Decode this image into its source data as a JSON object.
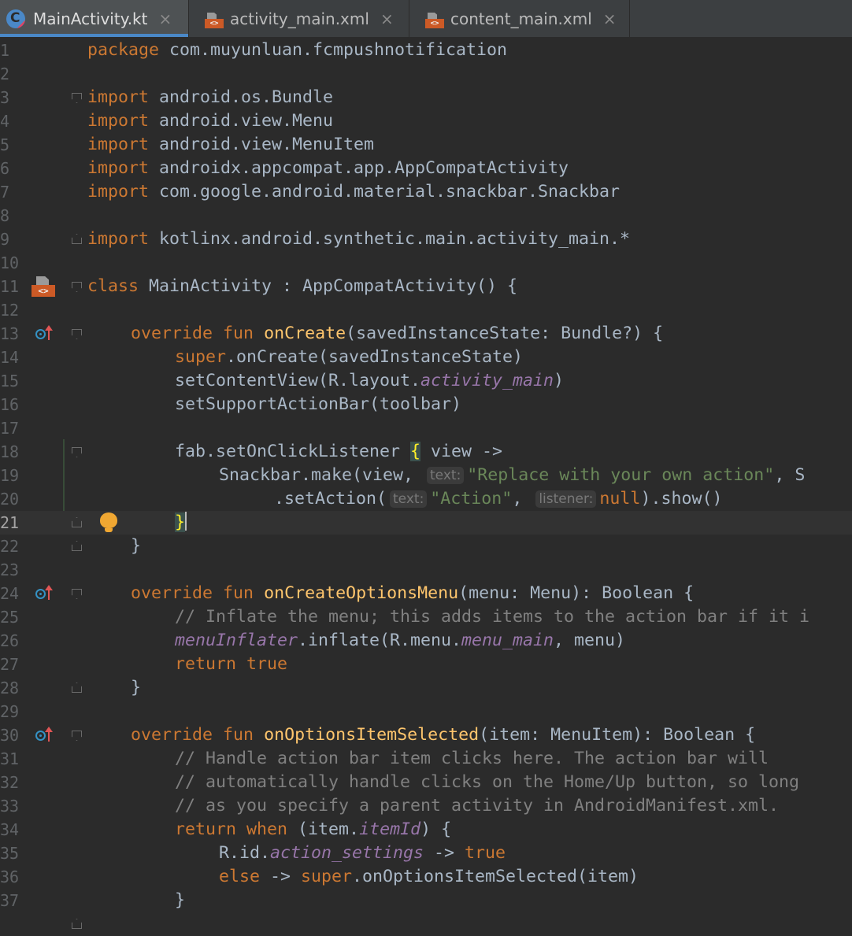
{
  "tabs": [
    {
      "label": "MainActivity.kt",
      "icon": "kotlin-file-icon",
      "active": true
    },
    {
      "label": "activity_main.xml",
      "icon": "xml-file-icon",
      "active": false
    },
    {
      "label": "content_main.xml",
      "icon": "xml-file-icon",
      "active": false
    }
  ],
  "tab_close_glyph": "×",
  "lines": [
    "1",
    "2",
    "3",
    "4",
    "5",
    "6",
    "7",
    "8",
    "9",
    "10",
    "11",
    "12",
    "13",
    "14",
    "15",
    "16",
    "17",
    "18",
    "19",
    "20",
    "21",
    "22",
    "23",
    "24",
    "25",
    "26",
    "27",
    "28",
    "29",
    "30",
    "31",
    "32",
    "33",
    "34",
    "35",
    "36",
    "37"
  ],
  "code": {
    "l1": {
      "kw": "package",
      "rest": " com.muyunluan.fcmpushnotification"
    },
    "l3": {
      "kw": "import",
      "rest": " android.os.Bundle"
    },
    "l4": {
      "kw": "import",
      "rest": " android.view.Menu"
    },
    "l5": {
      "kw": "import",
      "rest": " android.view.MenuItem"
    },
    "l6": {
      "kw": "import",
      "rest": " androidx.appcompat.app.AppCompatActivity"
    },
    "l7": {
      "kw": "import",
      "rest": " com.google.android.material.snackbar.Snackbar"
    },
    "l9": {
      "kw": "import",
      "rest": " kotlinx.android.synthetic.main.activity_main.*"
    },
    "l11": {
      "kw": "class",
      "rest": " MainActivity : AppCompatActivity() {"
    },
    "l13": {
      "kw1": "override",
      "kw2": "fun",
      "fn": "onCreate",
      "rest": "(savedInstanceState: Bundle?) {"
    },
    "l14": {
      "kw": "super",
      "rest": ".onCreate(savedInstanceState)"
    },
    "l15": {
      "a": "setContentView(R.layout.",
      "it": "activity_main",
      "b": ")"
    },
    "l16": {
      "a": "setSupportActionBar(toolbar)"
    },
    "l18": {
      "a": "fab.setOnClickListener ",
      "brace": "{",
      "b": " view ->"
    },
    "l19": {
      "a": "Snackbar.make(view, ",
      "hint": "text:",
      "str": "\"Replace with your own action\"",
      "b": ", S"
    },
    "l20": {
      "a": ".setAction(",
      "hint1": "text:",
      "str": "\"Action\"",
      "b": ", ",
      "hint2": "listener:",
      "kw": "null",
      "c": ").show()"
    },
    "l21": {
      "brace": "}"
    },
    "l22": {
      "a": "}"
    },
    "l24": {
      "kw1": "override",
      "kw2": "fun",
      "fn": "onCreateOptionsMenu",
      "rest": "(menu: Menu): Boolean {"
    },
    "l25": {
      "cm": "// Inflate the menu; this adds items to the action bar if it i"
    },
    "l26": {
      "it": "menuInflater",
      "a": ".inflate(R.menu.",
      "it2": "menu_main",
      "b": ", menu)"
    },
    "l27": {
      "kw1": "return",
      "kw2": "true"
    },
    "l28": {
      "a": "}"
    },
    "l30": {
      "kw1": "override",
      "kw2": "fun",
      "fn": "onOptionsItemSelected",
      "rest": "(item: MenuItem): Boolean {"
    },
    "l31": {
      "cm": "// Handle action bar item clicks here. The action bar will"
    },
    "l32": {
      "cm": "// automatically handle clicks on the Home/Up button, so long"
    },
    "l33": {
      "cm": "// as you specify a parent activity in AndroidManifest.xml."
    },
    "l34": {
      "kw1": "return",
      "kw2": "when",
      "a": " (item.",
      "it": "itemId",
      "b": ") {"
    },
    "l35": {
      "a": "R.id.",
      "it": "action_settings",
      "b": " -> ",
      "kw": "true"
    },
    "l36": {
      "kw1": "else",
      "a": " -> ",
      "kw2": "super",
      "b": ".onOptionsItemSelected(item)"
    },
    "l37": {
      "a": "}"
    }
  },
  "colors": {
    "background": "#2b2b2b",
    "keyword": "#cc7832",
    "function": "#ffc66d",
    "string": "#6a8759",
    "comment": "#808080",
    "field": "#9876aa",
    "text": "#a9b7c6"
  }
}
